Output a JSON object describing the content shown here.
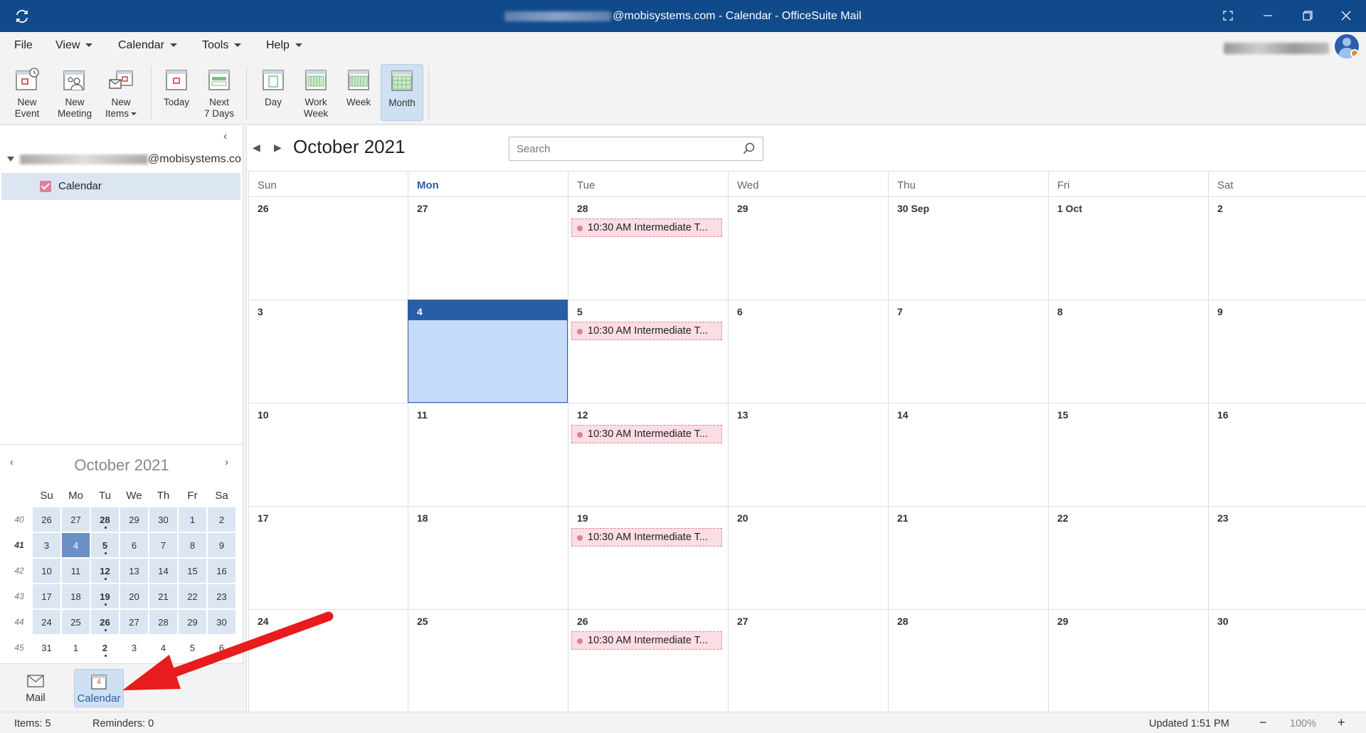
{
  "titlebar": {
    "title_suffix": "@mobisystems.com - Calendar - OfficeSuite Mail"
  },
  "menu": {
    "file": "File",
    "view": "View",
    "calendar": "Calendar",
    "tools": "Tools",
    "help": "Help"
  },
  "ribbon": {
    "new_event": [
      "New",
      "Event"
    ],
    "new_meeting": [
      "New",
      "Meeting"
    ],
    "new_items": [
      "New",
      "Items"
    ],
    "today": [
      "Today",
      ""
    ],
    "next7": [
      "Next",
      "7 Days"
    ],
    "day": [
      "Day",
      ""
    ],
    "work_week": [
      "Work",
      "Week"
    ],
    "week": [
      "Week",
      ""
    ],
    "month": [
      "Month",
      ""
    ]
  },
  "sidebar": {
    "account_suffix": "@mobisystems.com",
    "calendar_label": "Calendar"
  },
  "mini_calendar": {
    "title": "October 2021",
    "weekday_headers": [
      "Su",
      "Mo",
      "Tu",
      "We",
      "Th",
      "Fr",
      "Sa"
    ],
    "weeks": [
      {
        "wk": "40",
        "days": [
          "26",
          "27",
          "28",
          "29",
          "30",
          "1",
          "2"
        ]
      },
      {
        "wk": "41",
        "days": [
          "3",
          "4",
          "5",
          "6",
          "7",
          "8",
          "9"
        ]
      },
      {
        "wk": "42",
        "days": [
          "10",
          "11",
          "12",
          "13",
          "14",
          "15",
          "16"
        ]
      },
      {
        "wk": "43",
        "days": [
          "17",
          "18",
          "19",
          "20",
          "21",
          "22",
          "23"
        ]
      },
      {
        "wk": "44",
        "days": [
          "24",
          "25",
          "26",
          "27",
          "28",
          "29",
          "30"
        ]
      },
      {
        "wk": "45",
        "days": [
          "31",
          "1",
          "2",
          "3",
          "4",
          "5",
          "6"
        ]
      }
    ]
  },
  "bottom_nav": {
    "mail": "Mail",
    "calendar": "Calendar",
    "calendar_icon_day": "4"
  },
  "main": {
    "month_title": "October 2021",
    "search_placeholder": "Search",
    "weekdays": [
      "Sun",
      "Mon",
      "Tue",
      "Wed",
      "Thu",
      "Fri",
      "Sat"
    ],
    "weeks": [
      [
        "26",
        "27",
        "28",
        "29",
        "30 Sep",
        "1 Oct",
        "2"
      ],
      [
        "3",
        "4",
        "5",
        "6",
        "7",
        "8",
        "9"
      ],
      [
        "10",
        "11",
        "12",
        "13",
        "14",
        "15",
        "16"
      ],
      [
        "17",
        "18",
        "19",
        "20",
        "21",
        "22",
        "23"
      ],
      [
        "24",
        "25",
        "26",
        "27",
        "28",
        "29",
        "30"
      ]
    ],
    "event_label": "10:30 AM  Intermediate T..."
  },
  "status": {
    "items": "Items: 5",
    "reminders": "Reminders: 0",
    "updated": "Updated 1:51 PM",
    "zoom": "100%",
    "minus": "−",
    "plus": "+"
  },
  "colors": {
    "titlebar": "#114a8b",
    "accent": "#2a5da8",
    "event_bg": "#fbdde4",
    "event_dot": "#e0809c"
  }
}
